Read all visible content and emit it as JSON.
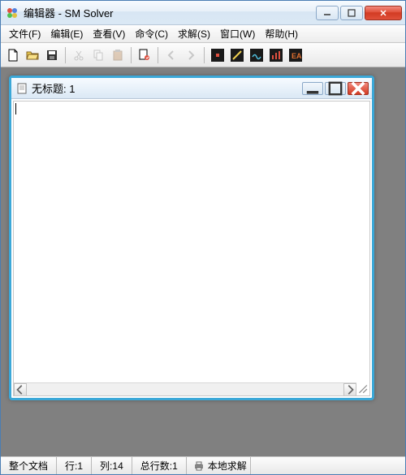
{
  "app": {
    "title": "编辑器 - SM Solver"
  },
  "menu": {
    "file": "文件(F)",
    "edit": "编辑(E)",
    "view": "查看(V)",
    "command": "命令(C)",
    "solve": "求解(S)",
    "window": "窗口(W)",
    "help": "帮助(H)"
  },
  "doc": {
    "title": "无标题: 1"
  },
  "status": {
    "scope": "整个文档",
    "line_label": "行:",
    "line_value": "1",
    "col_label": "列:",
    "col_value": "14",
    "total_label": "总行数:",
    "total_value": "1",
    "solve_mode": "本地求解"
  }
}
